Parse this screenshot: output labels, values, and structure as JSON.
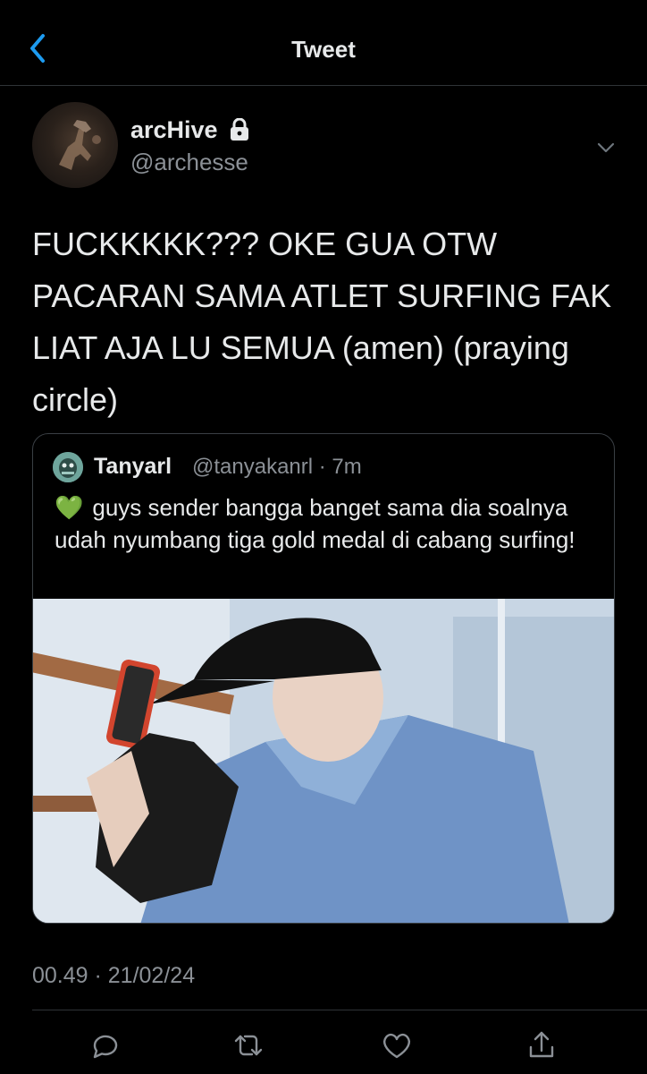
{
  "header": {
    "title": "Tweet"
  },
  "author": {
    "name": "arcHive",
    "handle": "@archesse",
    "avatar_icon": "profile-photo",
    "protected_icon": "lock-icon"
  },
  "tweet": {
    "text": "FUCKKKKK??? OKE GUA OTW PACARAN SAMA ATLET SURFING FAK LIAT AJA LU SEMUA (amen) (praying circle)",
    "timestamp": "00.49 · 21/02/24"
  },
  "quoted": {
    "name": "Tanyarl",
    "meta": "@tanyakanrl · 7m",
    "emoji": "💚",
    "text": "guys sender bangga banget sama dia soalnya udah nyumbang tiga gold medal di cabang surfing!",
    "media_icon": "photo"
  },
  "actions": [
    {
      "icon": "reply-icon"
    },
    {
      "icon": "retweet-icon"
    },
    {
      "icon": "like-icon"
    },
    {
      "icon": "share-icon"
    }
  ],
  "colors": {
    "accent": "#1d9bf0",
    "background": "#000000",
    "muted": "#8b9096"
  }
}
